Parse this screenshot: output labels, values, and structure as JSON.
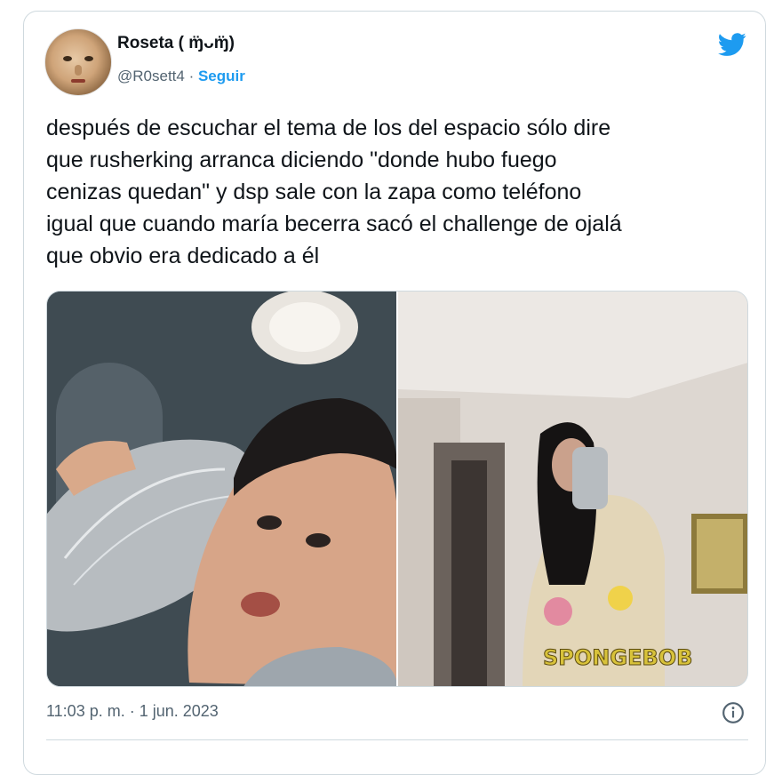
{
  "author": {
    "display_name": "Roseta ( ɱ̈ᴗɱ̈)",
    "handle": "@R0sett4",
    "separator": " · ",
    "follow_label": "Seguir"
  },
  "tweet": {
    "text": "después de escuchar el tema de los del espacio sólo dire\nque rusherking arranca diciendo \"donde hubo fuego\ncenizas quedan\" y dsp sale con la zapa como teléfono\nigual que cuando maría becerra sacó el challenge de ojalá\nque obvio era dedicado a él",
    "timestamp": "11:03 p. m. · 1 jun. 2023"
  },
  "media": {
    "right_photo_shirt_text": "SPONGEBOB"
  },
  "colors": {
    "accent": "#1d9bf0",
    "text": "#0f1419",
    "secondary": "#536471",
    "border": "#cfd9de"
  },
  "icons": {
    "brand": "twitter-bird-icon",
    "info": "info-icon"
  }
}
